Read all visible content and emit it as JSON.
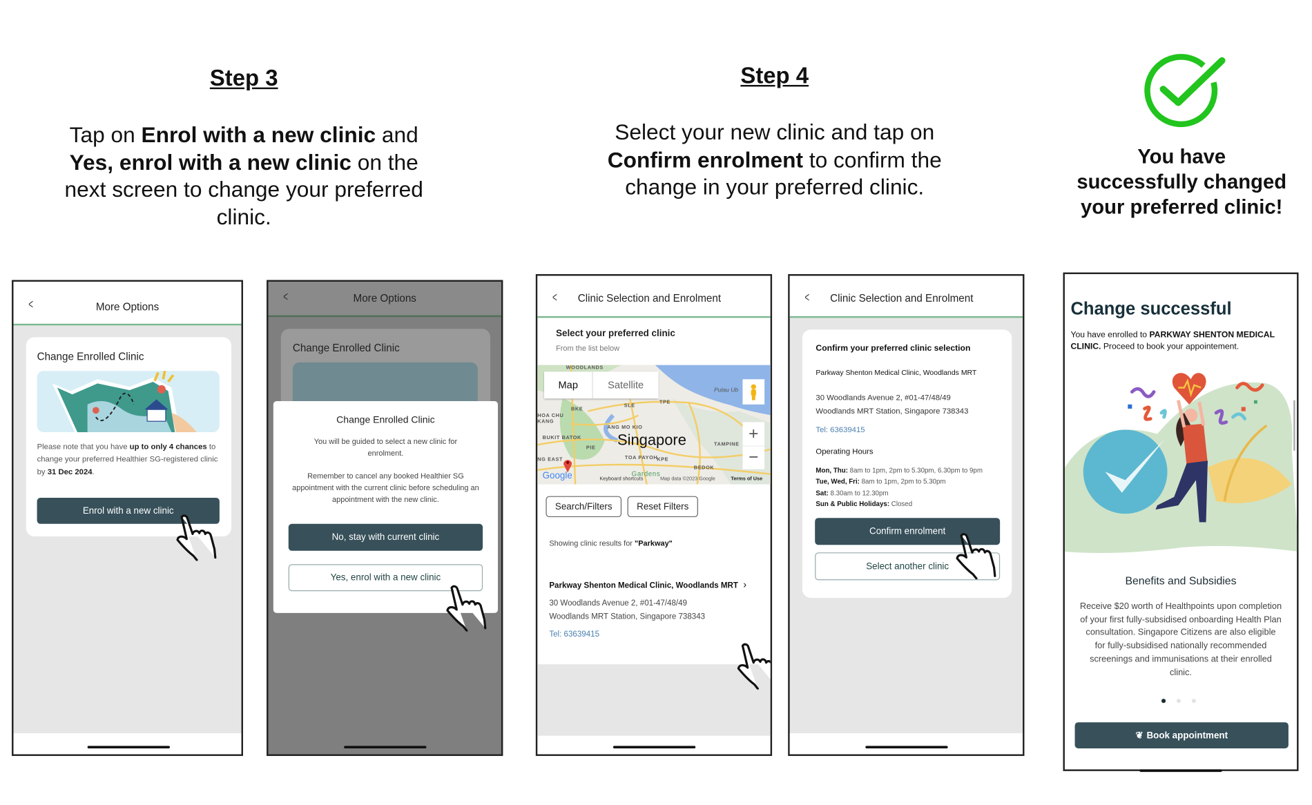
{
  "step3": {
    "title": "Step 3",
    "lines": [
      [
        "Tap on ",
        "Enrol with a new clinic",
        " and"
      ],
      [
        "Yes, enrol with a new clinic",
        " on the"
      ],
      [
        "next screen to change your preferred"
      ],
      [
        "clinic."
      ]
    ]
  },
  "step4": {
    "title": "Step 4",
    "lines": [
      [
        "Select your new clinic and tap on"
      ],
      [
        "Confirm enrolment",
        " to confirm the"
      ],
      [
        "change in your preferred clinic."
      ]
    ]
  },
  "success": {
    "icon": "check-circle-icon",
    "color": "#22c41e",
    "lines": [
      "You have",
      "successfully changed",
      "your preferred clinic!"
    ]
  },
  "screen1": {
    "header": "More Options",
    "card_title": "Change Enrolled Clinic",
    "note": [
      "Please note that you have ",
      "up to only 4 chances",
      " to change your preferred Healthier SG-registered clinic by ",
      "31 Dec 2024",
      "."
    ],
    "button": "Enrol with a new clinic"
  },
  "screen2": {
    "header": "More Options",
    "card_title": "Change Enrolled Clinic",
    "modal_title": "Change Enrolled Clinic",
    "modal_text1": "You will be guided to select a new clinic for enrolment.",
    "modal_text2": "Remember to cancel any booked Healthier SG appointment with the current clinic before scheduling an appointment with the new clinic.",
    "btn_no": "No, stay with current clinic",
    "btn_yes": "Yes, enrol with a new clinic"
  },
  "screen3": {
    "header": "Clinic Selection and Enrolment",
    "title": "Select your preferred clinic",
    "subtitle": "From the list below",
    "map": {
      "tab_map": "Map",
      "tab_satellite": "Satellite",
      "city": "Singapore",
      "labels": [
        "WOODLANDS",
        "Pulau Ub",
        "SLE",
        "TPE",
        "BKE",
        "HOA CHU",
        "KANG",
        "ANG MO KIO",
        "BUKIT BATOK",
        "PIE",
        "TAMPINE",
        "TOA PAYOH",
        "KPE",
        "BEDOK",
        "NG EAST",
        "Gardens"
      ],
      "zoom_in": "+",
      "zoom_out": "−",
      "logo": "Google",
      "shortcuts": "Keyboard shortcuts",
      "mapdata": "Map data ©2023 Google",
      "terms": "Terms of Use"
    },
    "btn_search": "Search/Filters",
    "btn_reset": "Reset Filters",
    "results_prefix": "Showing clinic results for ",
    "results_query": "\"Parkway\"",
    "clinic": {
      "name": "Parkway Shenton Medical Clinic, Woodlands MRT",
      "addr1": "30 Woodlands Avenue 2, #01-47/48/49",
      "addr2": "Woodlands MRT Station, Singapore 738343",
      "tel": "Tel: 63639415"
    }
  },
  "screen4": {
    "header": "Clinic Selection and Enrolment",
    "title": "Confirm your preferred clinic selection",
    "name": "Parkway Shenton Medical Clinic, Woodlands MRT",
    "addr1": "30 Woodlands Avenue 2, #01-47/48/49",
    "addr2": "Woodlands MRT Station, Singapore 738343",
    "tel": "Tel: 63639415",
    "hours_title": "Operating Hours",
    "hours": [
      {
        "d": "Mon, Thu:",
        "t": " 8am to 1pm, 2pm to 5.30pm, 6.30pm to 9pm"
      },
      {
        "d": "Tue, Wed, Fri:",
        "t": " 8am to 1pm, 2pm to 5.30pm"
      },
      {
        "d": "Sat:",
        "t": " 8.30am to 12.30pm"
      },
      {
        "d": "Sun & Public Holidays:",
        "t": " Closed"
      }
    ],
    "btn_confirm": "Confirm enrolment",
    "btn_other": "Select another clinic"
  },
  "screen5": {
    "title": "Change successful",
    "text_prefix": "You have enrolled to ",
    "clinic": "PARKWAY SHENTON MEDICAL CLINIC.",
    "text_suffix": " Proceed to book your appointement.",
    "section_title": "Benefits and Subsidies",
    "paragraph": "Receive $20 worth of Healthpoints upon completion of your first fully-subsidised onboarding Health Plan consultation. Singapore Citizens are also eligible for fully-subsidised nationally recommended screenings and immunisations at their enrolled clinic.",
    "carousel": {
      "pages": 3,
      "active": 1
    },
    "button": "Book appointment"
  },
  "colors": {
    "primary_button": "#37505a",
    "header_line": "#7cb98f",
    "link": "#4a7fb0",
    "success_check": "#22c41e"
  }
}
